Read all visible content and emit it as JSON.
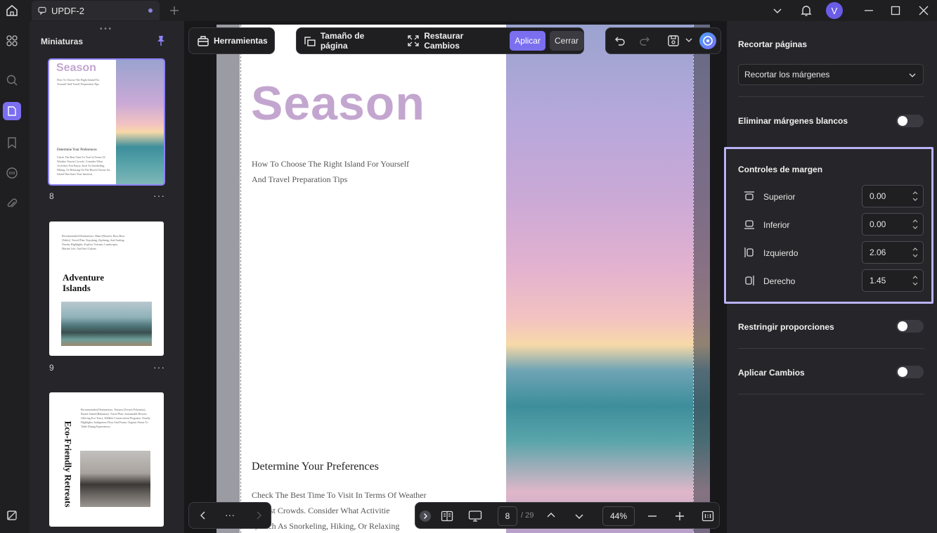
{
  "titlebar": {
    "tab_title": "UPDF-2",
    "avatar_letter": "V"
  },
  "thumbnails": {
    "title": "Miniaturas",
    "pages": [
      {
        "number": "8",
        "heading": "Season",
        "subheading": "Determine Your Preferences"
      },
      {
        "number": "9",
        "heading": "Adventure Islands"
      },
      {
        "heading": "Eco-Friendly Retreats"
      }
    ],
    "more": "···"
  },
  "toolbar": {
    "tools_label": "Herramientas",
    "page_size_label": "Tamaño de página",
    "restore_label": "Restaurar Cambios",
    "apply_label": "Aplicar",
    "close_label": "Cerrar"
  },
  "page": {
    "title": "Season",
    "subtitle_line1": "How To Choose The Right Island For Yourself",
    "subtitle_line2": "And Travel Preparation Tips",
    "section_heading": "Determine Your Preferences",
    "body_line1": "Check The Best Time To Visit In Terms Of Weather",
    "body_line2": "Tourist Crowds. Consider What Activitie",
    "body_line3": "s, Such As Snorkeling, Hiking, Or Relaxing"
  },
  "bottombar": {
    "more": "···",
    "current_page": "8",
    "total_pages": "/ 29",
    "zoom": "44%"
  },
  "rightpanel": {
    "crop_title": "Recortar páginas",
    "crop_option": "Recortar los márgenes",
    "remove_white": "Eliminar márgenes blancos",
    "margin_controls": "Controles de margen",
    "margins": [
      {
        "label": "Superior",
        "value": "0.00"
      },
      {
        "label": "Inferior",
        "value": "0.00"
      },
      {
        "label": "Izquierdo",
        "value": "2.06"
      },
      {
        "label": "Derecho",
        "value": "1.45"
      }
    ],
    "restrict": "Restringir proporciones",
    "apply_changes": "Aplicar Cambios"
  },
  "colors": {
    "accent": "#7b6ff0",
    "highlight_border": "#b9b2f5",
    "season_title": "#c3a6cf"
  }
}
